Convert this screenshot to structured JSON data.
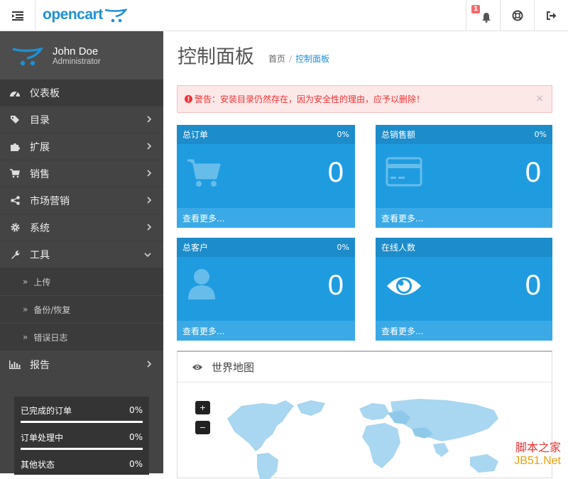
{
  "header": {
    "logo_text": "opencart",
    "notification_count": "1"
  },
  "sidebar": {
    "user_name": "John Doe",
    "user_role": "Administrator",
    "items": [
      {
        "label": "仪表板",
        "icon": "dashboard-icon"
      },
      {
        "label": "目录",
        "icon": "tags-icon"
      },
      {
        "label": "扩展",
        "icon": "puzzle-icon"
      },
      {
        "label": "销售",
        "icon": "cart-icon"
      },
      {
        "label": "市场营销",
        "icon": "share-icon"
      },
      {
        "label": "系统",
        "icon": "gear-icon"
      },
      {
        "label": "工具",
        "icon": "wrench-icon"
      },
      {
        "label": "报告",
        "icon": "bar-chart-icon"
      }
    ],
    "sub_items": [
      {
        "label": "上传"
      },
      {
        "label": "备份/恢复"
      },
      {
        "label": "错误日志"
      }
    ],
    "progress": [
      {
        "label": "已完成的订单",
        "value": "0%",
        "fraction": 0
      },
      {
        "label": "订单处理中",
        "value": "0%",
        "fraction": 0
      },
      {
        "label": "其他状态",
        "value": "0%",
        "fraction": 0
      }
    ]
  },
  "main": {
    "title": "控制面板",
    "breadcrumb_home": "首页",
    "breadcrumb_current": "控制面板",
    "alert": "警告：安装目录仍然存在，因为安全性的理由，应予以删除！",
    "alert_close": "×",
    "tiles": [
      {
        "title": "总订单",
        "pct": "0%",
        "value": "0",
        "more": "查看更多...",
        "icon": "cart-icon"
      },
      {
        "title": "总销售额",
        "pct": "0%",
        "value": "0",
        "more": "查看更多...",
        "icon": "credit-card-icon"
      },
      {
        "title": "总客户",
        "pct": "0%",
        "value": "0",
        "more": "查看更多...",
        "icon": "user-icon"
      },
      {
        "title": "在线人数",
        "pct": "",
        "value": "0",
        "more": "查看更多...",
        "icon": "eye-icon"
      }
    ],
    "map": {
      "title": "世界地图",
      "zoom_in": "+",
      "zoom_out": "−"
    }
  },
  "watermark": {
    "line1": "脚本之家",
    "line2": "JB51.Net"
  },
  "colors": {
    "brand": "#1f90d4",
    "tile": "#1f9ce0",
    "sidebar": "#444444",
    "alert": "#ee3333"
  }
}
